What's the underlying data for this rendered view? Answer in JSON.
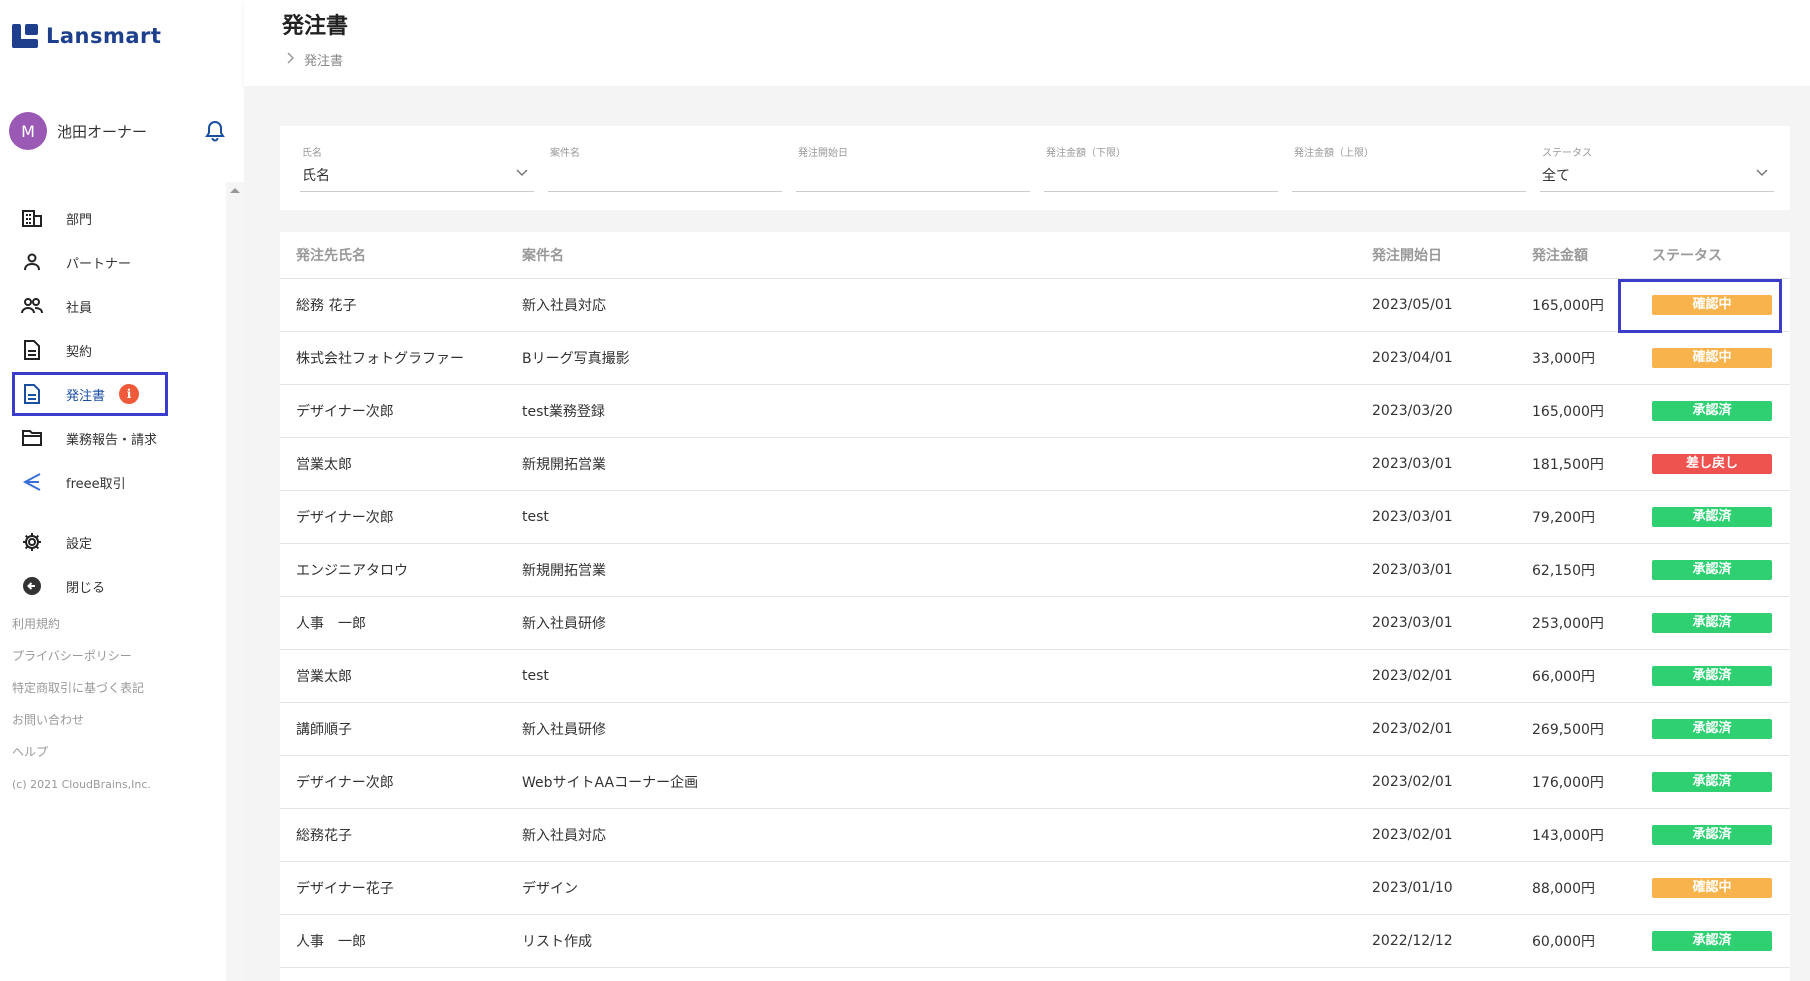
{
  "app": {
    "logo_text": "Lansmart"
  },
  "user": {
    "initial": "M",
    "name": "池田オーナー",
    "icon": "bell-icon"
  },
  "sidebar": {
    "items": [
      {
        "label": "部門",
        "icon": "building-icon"
      },
      {
        "label": "パートナー",
        "icon": "person-icon"
      },
      {
        "label": "社員",
        "icon": "people-icon"
      },
      {
        "label": "契約",
        "icon": "document-icon"
      },
      {
        "label": "発注書",
        "icon": "document-icon",
        "active": true,
        "badge": "i"
      },
      {
        "label": "業務報告・請求",
        "icon": "folder-icon"
      },
      {
        "label": "freee取引",
        "icon": "freee-icon"
      },
      {
        "label": "設定",
        "icon": "gear-icon"
      },
      {
        "label": "閉じる",
        "icon": "arrow-left-circle-icon"
      }
    ],
    "links": [
      "利用規約",
      "プライバシーポリシー",
      "特定商取引に基づく表記",
      "お問い合わせ",
      "ヘルプ"
    ],
    "copyright": "(c) 2021 CloudBrains,Inc."
  },
  "header": {
    "title": "発注書",
    "breadcrumb": "発注書"
  },
  "filters": {
    "name": {
      "label": "氏名",
      "value": "氏名"
    },
    "project": {
      "label": "案件名",
      "value": ""
    },
    "start_date": {
      "label": "発注開始日",
      "value": ""
    },
    "amount_min": {
      "label": "発注金額（下限）",
      "value": ""
    },
    "amount_max": {
      "label": "発注金額（上限）",
      "value": ""
    },
    "status": {
      "label": "ステータス",
      "value": "全て"
    }
  },
  "table": {
    "columns": [
      "発注先氏名",
      "案件名",
      "発注開始日",
      "発注金額",
      "ステータス"
    ],
    "rows": [
      {
        "name": "総務 花子",
        "project": "新入社員対応",
        "date": "2023/05/01",
        "amount": "165,000円",
        "status": "確認中",
        "type": "pending"
      },
      {
        "name": "株式会社フォトグラファー",
        "project": "Bリーグ写真撮影",
        "date": "2023/04/01",
        "amount": "33,000円",
        "status": "確認中",
        "type": "pending"
      },
      {
        "name": "デザイナー次郎",
        "project": "test業務登録",
        "date": "2023/03/20",
        "amount": "165,000円",
        "status": "承認済",
        "type": "approved"
      },
      {
        "name": "営業太郎",
        "project": "新規開拓営業",
        "date": "2023/03/01",
        "amount": "181,500円",
        "status": "差し戻し",
        "type": "returned"
      },
      {
        "name": "デザイナー次郎",
        "project": "test",
        "date": "2023/03/01",
        "amount": "79,200円",
        "status": "承認済",
        "type": "approved"
      },
      {
        "name": "エンジニアタロウ",
        "project": "新規開拓営業",
        "date": "2023/03/01",
        "amount": "62,150円",
        "status": "承認済",
        "type": "approved"
      },
      {
        "name": "人事　一郎",
        "project": "新入社員研修",
        "date": "2023/03/01",
        "amount": "253,000円",
        "status": "承認済",
        "type": "approved"
      },
      {
        "name": "営業太郎",
        "project": "test",
        "date": "2023/02/01",
        "amount": "66,000円",
        "status": "承認済",
        "type": "approved"
      },
      {
        "name": "講師順子",
        "project": "新入社員研修",
        "date": "2023/02/01",
        "amount": "269,500円",
        "status": "承認済",
        "type": "approved"
      },
      {
        "name": "デザイナー次郎",
        "project": "WebサイトAAコーナー企画",
        "date": "2023/02/01",
        "amount": "176,000円",
        "status": "承認済",
        "type": "approved"
      },
      {
        "name": "総務花子",
        "project": "新入社員対応",
        "date": "2023/02/01",
        "amount": "143,000円",
        "status": "承認済",
        "type": "approved"
      },
      {
        "name": "デザイナー花子",
        "project": "デザイン",
        "date": "2023/01/10",
        "amount": "88,000円",
        "status": "確認中",
        "type": "pending"
      },
      {
        "name": "人事　一郎",
        "project": "リスト作成",
        "date": "2022/12/12",
        "amount": "60,000円",
        "status": "承認済",
        "type": "approved"
      }
    ]
  },
  "colors": {
    "brand": "#1d3f8c",
    "pending": "#f9b34d",
    "approved": "#2ed072",
    "returned": "#ef5350",
    "highlight": "#3c3ccc"
  }
}
